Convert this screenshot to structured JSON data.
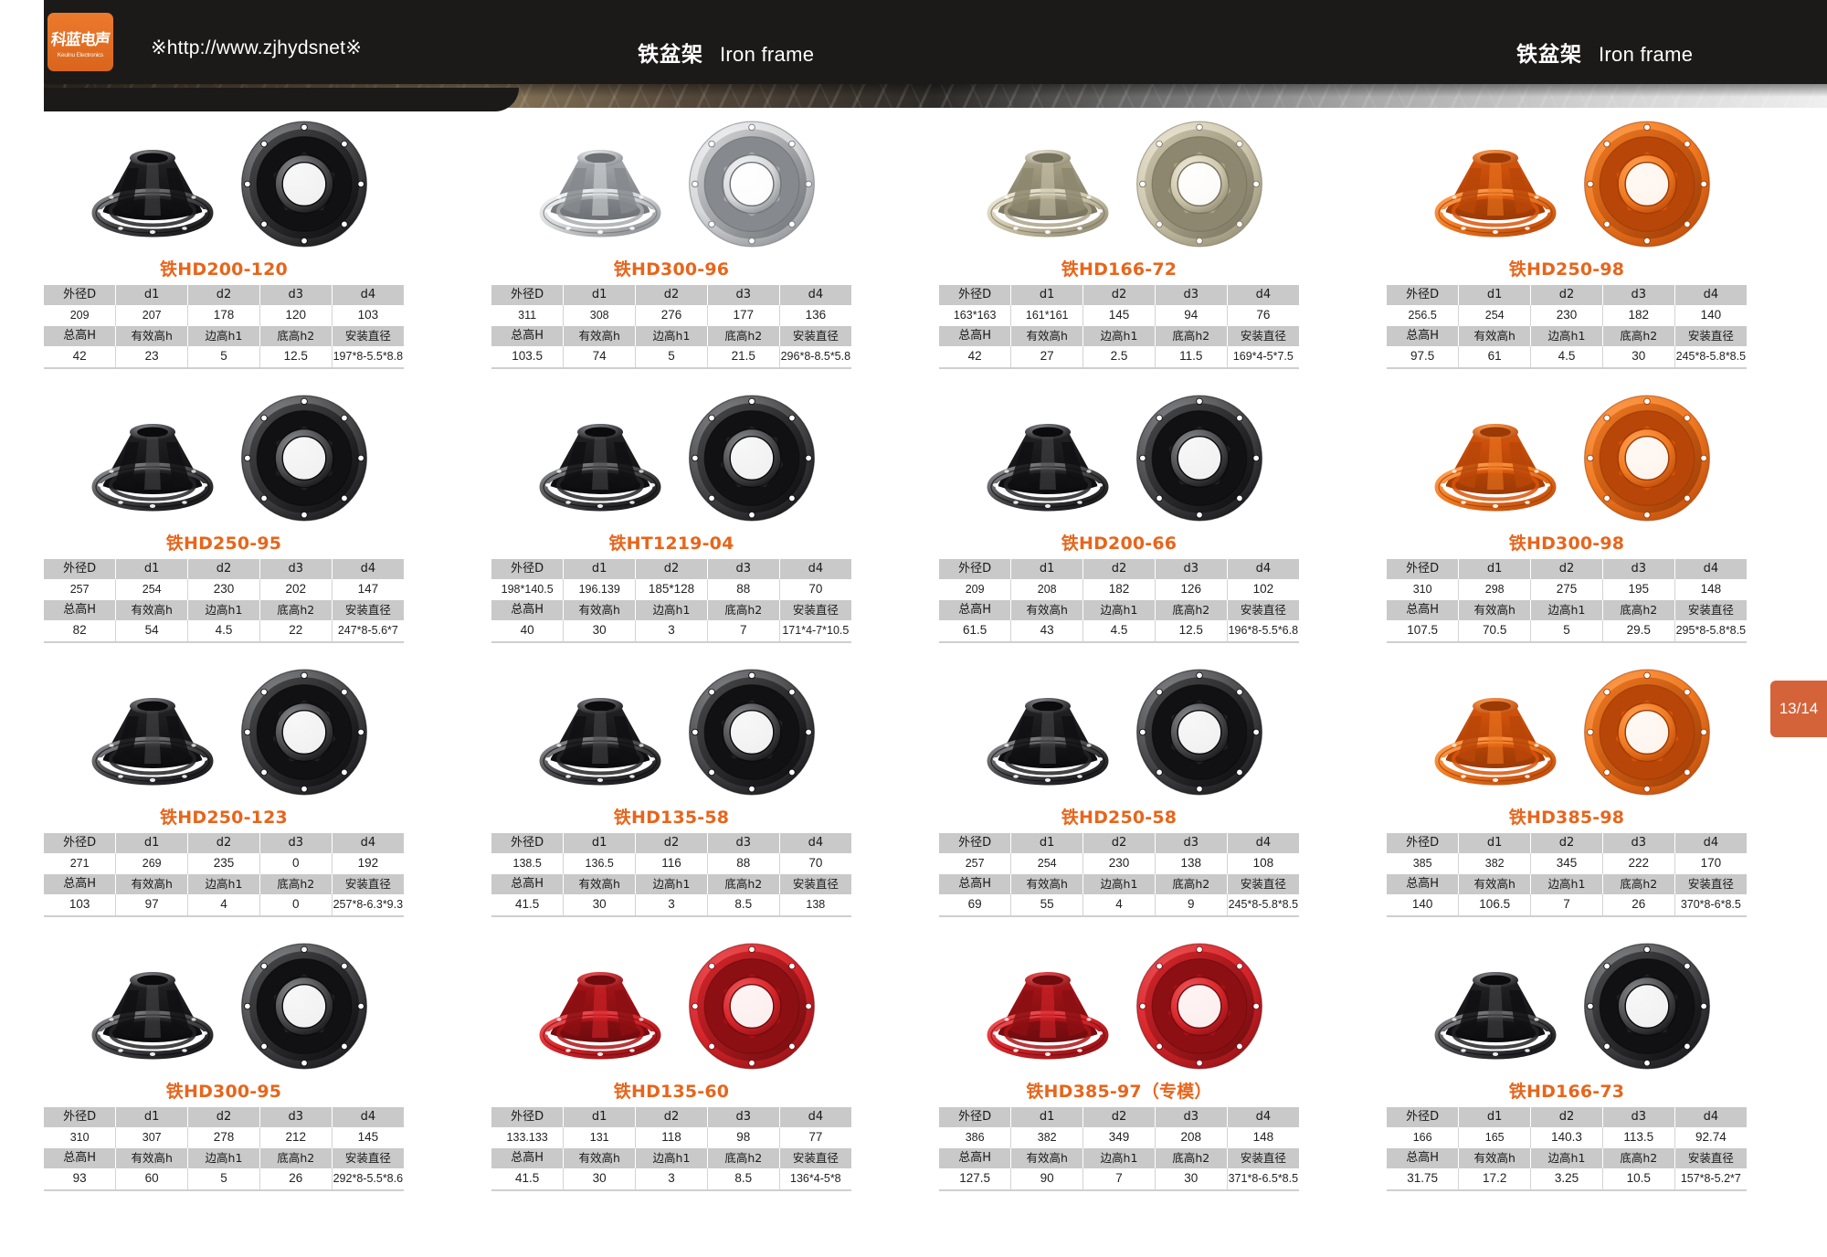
{
  "header": {
    "logo_cn": "科蓝电声",
    "logo_en": "Keulnu Electronics",
    "url": "※http://www.zjhydsnet※",
    "center_title_cn": "铁盆架",
    "center_title_en": "Iron frame",
    "right_title_cn": "铁盆架",
    "right_title_en": "Iron frame"
  },
  "page_tab": {
    "label": "13/14"
  },
  "table_headers": {
    "row1": [
      "外径D",
      "d1",
      "d2",
      "d3",
      "d4"
    ],
    "row2": [
      "总高H",
      "有效高h",
      "边高h1",
      "底高h2",
      "安装直径"
    ]
  },
  "products": [
    {
      "model": "铁HD200-120",
      "color": "black",
      "values_1": [
        "209",
        "207",
        "178",
        "120",
        "103"
      ],
      "values_2": [
        "42",
        "23",
        "5",
        "12.5",
        "197*8-5.5*8.8"
      ]
    },
    {
      "model": "铁HD300-96",
      "color": "silver",
      "values_1": [
        "311",
        "308",
        "276",
        "177",
        "136"
      ],
      "values_2": [
        "103.5",
        "74",
        "5",
        "21.5",
        "296*8-8.5*5.8"
      ]
    },
    {
      "model": "铁HD166-72",
      "color": "zinc",
      "values_1": [
        "163*163",
        "161*161",
        "145",
        "94",
        "76"
      ],
      "values_2": [
        "42",
        "27",
        "2.5",
        "11.5",
        "169*4-5*7.5"
      ]
    },
    {
      "model": "铁HD250-98",
      "color": "orange",
      "values_1": [
        "256.5",
        "254",
        "230",
        "182",
        "140"
      ],
      "values_2": [
        "97.5",
        "61",
        "4.5",
        "30",
        "245*8-5.8*8.5"
      ]
    },
    {
      "model": "铁HD250-95",
      "color": "black",
      "values_1": [
        "257",
        "254",
        "230",
        "202",
        "147"
      ],
      "values_2": [
        "82",
        "54",
        "4.5",
        "22",
        "247*8-5.6*7"
      ]
    },
    {
      "model": "铁HT1219-04",
      "color": "black",
      "values_1": [
        "198*140.5",
        "196.139",
        "185*128",
        "88",
        "70"
      ],
      "values_2": [
        "40",
        "30",
        "3",
        "7",
        "171*4-7*10.5"
      ]
    },
    {
      "model": "铁HD200-66",
      "color": "black",
      "values_1": [
        "209",
        "208",
        "182",
        "126",
        "102"
      ],
      "values_2": [
        "61.5",
        "43",
        "4.5",
        "12.5",
        "196*8-5.5*6.8"
      ]
    },
    {
      "model": "铁HD300-98",
      "color": "orange",
      "values_1": [
        "310",
        "298",
        "275",
        "195",
        "148"
      ],
      "values_2": [
        "107.5",
        "70.5",
        "5",
        "29.5",
        "295*8-5.8*8.5"
      ]
    },
    {
      "model": "铁HD250-123",
      "color": "black",
      "values_1": [
        "271",
        "269",
        "235",
        "0",
        "192"
      ],
      "values_2": [
        "103",
        "97",
        "4",
        "0",
        "257*8-6.3*9.3"
      ]
    },
    {
      "model": "铁HD135-58",
      "color": "black",
      "values_1": [
        "138.5",
        "136.5",
        "116",
        "88",
        "70"
      ],
      "values_2": [
        "41.5",
        "30",
        "3",
        "8.5",
        "138"
      ]
    },
    {
      "model": "铁HD250-58",
      "color": "black",
      "values_1": [
        "257",
        "254",
        "230",
        "138",
        "108"
      ],
      "values_2": [
        "69",
        "55",
        "4",
        "9",
        "245*8-5.8*8.5"
      ]
    },
    {
      "model": "铁HD385-98",
      "color": "orange",
      "values_1": [
        "385",
        "382",
        "345",
        "222",
        "170"
      ],
      "values_2": [
        "140",
        "106.5",
        "7",
        "26",
        "370*8-6*8.5"
      ]
    },
    {
      "model": "铁HD300-95",
      "color": "black",
      "values_1": [
        "310",
        "307",
        "278",
        "212",
        "145"
      ],
      "values_2": [
        "93",
        "60",
        "5",
        "26",
        "292*8-5.5*8.6"
      ]
    },
    {
      "model": "铁HD135-60",
      "color": "red",
      "values_1": [
        "133.133",
        "131",
        "118",
        "98",
        "77"
      ],
      "values_2": [
        "41.5",
        "30",
        "3",
        "8.5",
        "136*4-5*8"
      ]
    },
    {
      "model": "铁HD385-97（专模）",
      "color": "red",
      "values_1": [
        "386",
        "382",
        "349",
        "208",
        "148"
      ],
      "values_2": [
        "127.5",
        "90",
        "7",
        "30",
        "371*8-6.5*8.5"
      ]
    },
    {
      "model": "铁HD166-73",
      "color": "black",
      "values_1": [
        "166",
        "165",
        "140.3",
        "113.5",
        "92.74"
      ],
      "values_2": [
        "31.75",
        "17.2",
        "3.25",
        "10.5",
        "157*8-5.2*7"
      ]
    }
  ],
  "colors": {
    "accent_orange": "#e8651b",
    "header_bg": "#1c1a18",
    "tab_bg": "#d4633a",
    "table_header_bg": "#c9c9c9"
  }
}
